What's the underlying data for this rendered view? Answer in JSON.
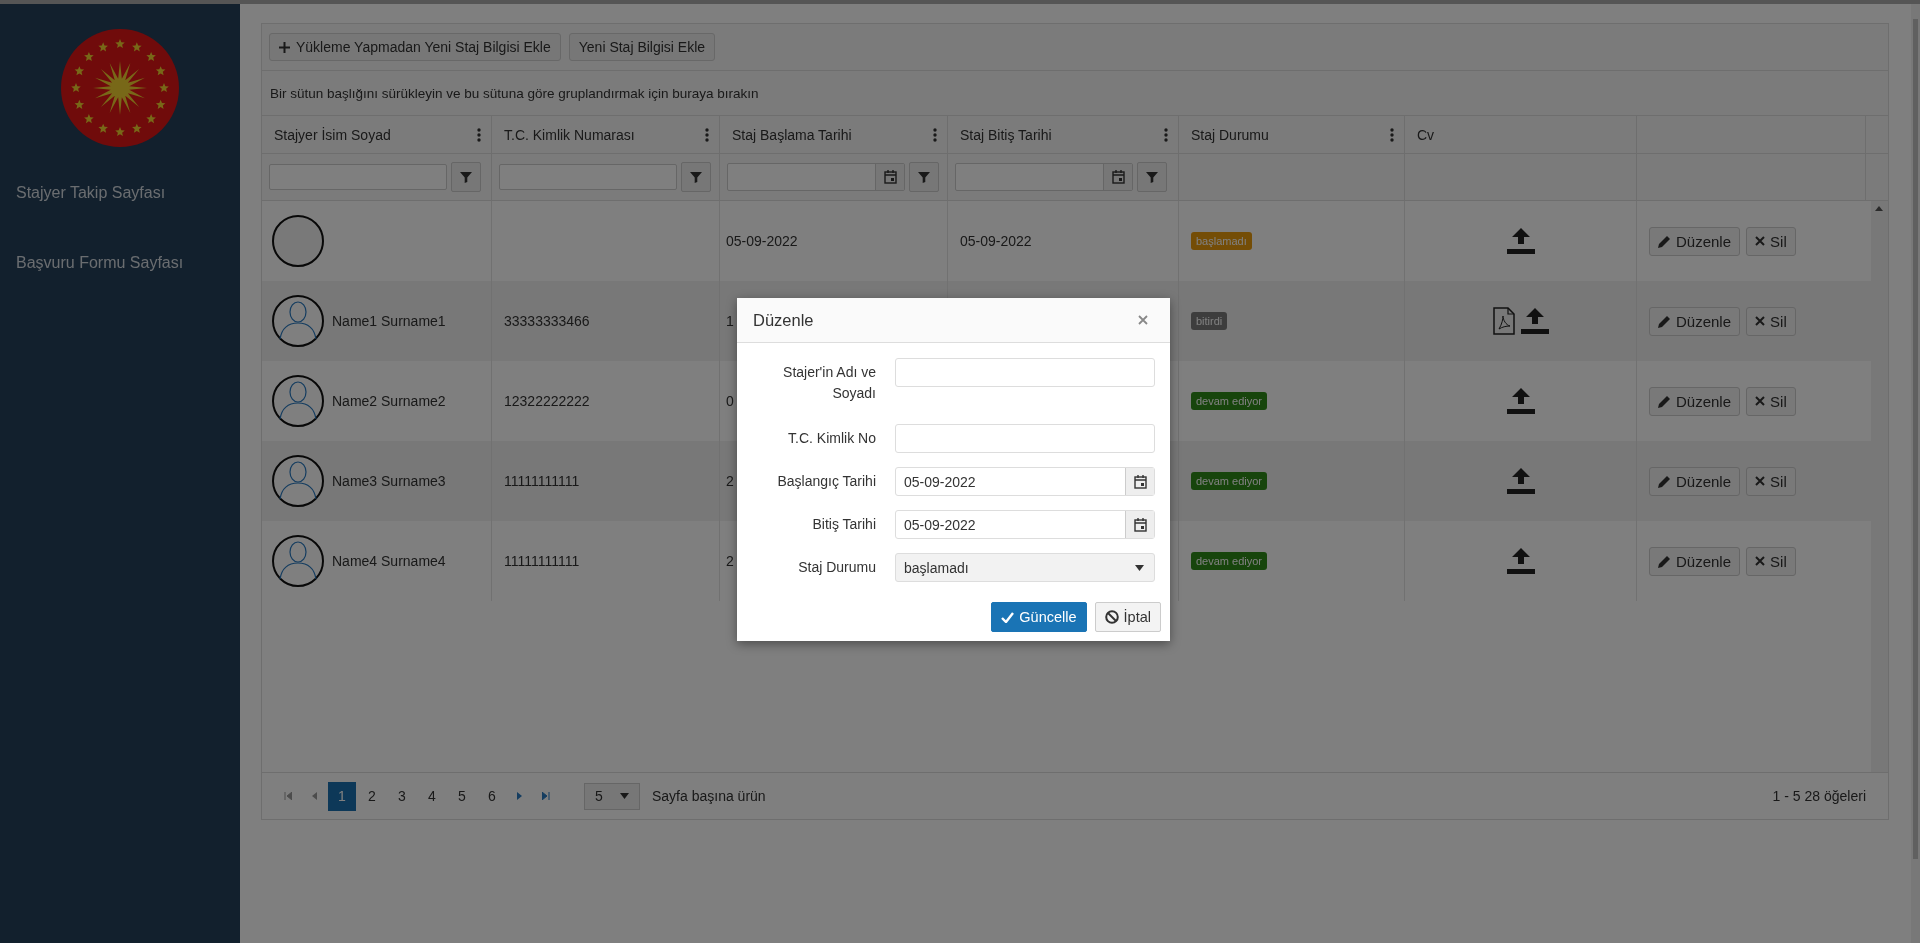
{
  "sidebar": {
    "items": [
      {
        "label": "Stajyer Takip Sayfası"
      },
      {
        "label": "Başvuru Formu Sayfası"
      }
    ]
  },
  "toolbar": {
    "buttons": [
      {
        "label": "Yükleme Yapmadan Yeni Staj Bilgisi Ekle",
        "kind": "add"
      },
      {
        "label": "Yeni Staj Bilgisi Ekle",
        "kind": "plain"
      }
    ]
  },
  "group_hint": "Bir sütun başlığını sürükleyin ve bu sütuna göre gruplandırmak için buraya bırakın",
  "table": {
    "columns": [
      {
        "label": "Stajyer İsim Soyad",
        "menu": true,
        "filter": {
          "kind": "text"
        }
      },
      {
        "label": "T.C. Kimlik Numarası",
        "menu": true,
        "filter": {
          "kind": "text"
        }
      },
      {
        "label": "Staj Başlama Tarihi",
        "menu": true,
        "filter": {
          "kind": "date"
        }
      },
      {
        "label": "Staj Bitiş Tarihi",
        "menu": true,
        "filter": {
          "kind": "date"
        }
      },
      {
        "label": "Staj Durumu",
        "menu": true,
        "filter": {
          "kind": "none"
        }
      },
      {
        "label": "Cv",
        "menu": false,
        "filter": {
          "kind": "none"
        }
      },
      {
        "menu": false,
        "filter": {
          "kind": "none"
        }
      }
    ],
    "rows": [
      {
        "avatar": {
          "kind": "empty"
        },
        "start": "05-09-2022",
        "end": "05-09-2022",
        "status": {
          "label": "başlamadı",
          "kind": "waiting"
        },
        "cv_pdf": false,
        "actions": [
          "Düzenle",
          "Sil"
        ]
      },
      {
        "avatar": {
          "kind": "silhouette"
        },
        "name": "Name1 Surname1",
        "id": "33333333466",
        "start": "1",
        "status": {
          "label": "bitirdi",
          "kind": "done"
        },
        "cv_pdf": true,
        "actions": [
          "Düzenle",
          "Sil"
        ]
      },
      {
        "avatar": {
          "kind": "silhouette"
        },
        "name": "Name2 Surname2",
        "id": "12322222222",
        "start": "0",
        "status": {
          "label": "devam ediyor",
          "kind": "ongoing"
        },
        "cv_pdf": false,
        "actions": [
          "Düzenle",
          "Sil"
        ]
      },
      {
        "avatar": {
          "kind": "silhouette"
        },
        "name": "Name3 Surname3",
        "id": "11111111111",
        "start": "2",
        "status": {
          "label": "devam ediyor",
          "kind": "ongoing"
        },
        "cv_pdf": false,
        "actions": [
          "Düzenle",
          "Sil"
        ]
      },
      {
        "avatar": {
          "kind": "silhouette"
        },
        "name": "Name4 Surname4",
        "id": "11111111111",
        "start": "2",
        "status": {
          "label": "devam ediyor",
          "kind": "ongoing"
        },
        "cv_pdf": false,
        "actions": [
          "Düzenle",
          "Sil"
        ]
      }
    ]
  },
  "pager": {
    "nav_before": [
      {
        "kind": "first",
        "disabled": true
      },
      {
        "kind": "prev",
        "disabled": true
      }
    ],
    "pages": [
      {
        "label": "1",
        "selected": true
      },
      {
        "label": "2",
        "selected": false
      },
      {
        "label": "3",
        "selected": false
      },
      {
        "label": "4",
        "selected": false
      },
      {
        "label": "5",
        "selected": false
      },
      {
        "label": "6",
        "selected": false
      }
    ],
    "nav_after": [
      {
        "kind": "next",
        "disabled": false
      },
      {
        "kind": "last",
        "disabled": false
      }
    ],
    "page_size": "5",
    "page_size_label": "Sayfa başına ürün",
    "summary": "1 - 5 28 öğeleri"
  },
  "modal": {
    "title": "Düzenle",
    "fields": [
      {
        "label": "Stajer'in Adı ve Soyadı",
        "kind": "text"
      },
      {
        "label": "T.C. Kimlik No",
        "kind": "text"
      },
      {
        "label": "Başlangıç Tarihi",
        "kind": "date",
        "value": "05-09-2022"
      },
      {
        "label": "Bitiş Tarihi",
        "kind": "date",
        "value": "05-09-2022"
      },
      {
        "label": "Staj Durumu",
        "kind": "select",
        "value": "başlamadı"
      }
    ],
    "buttons": [
      {
        "label": "Güncelle",
        "kind": "primary"
      },
      {
        "label": "İptal",
        "kind": "cancel"
      }
    ]
  }
}
